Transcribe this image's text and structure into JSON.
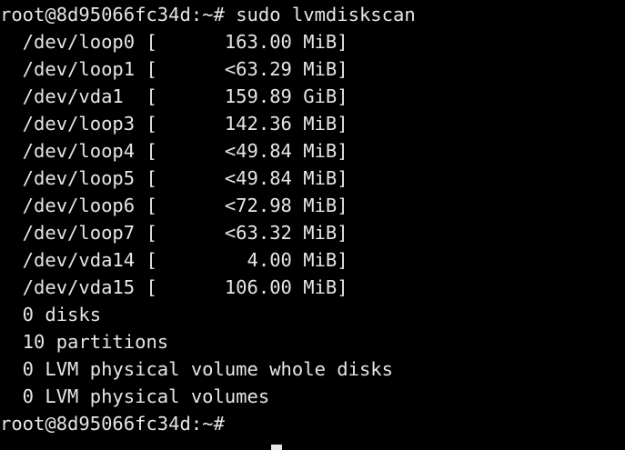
{
  "terminal": {
    "colors": {
      "background": "#000000",
      "foreground": "#e6e6e6"
    },
    "prompt": "root@8d95066fc34d:~#",
    "command": "sudo lvmdiskscan",
    "output": [
      "  /dev/loop0 [      163.00 MiB]",
      "  /dev/loop1 [      <63.29 MiB]",
      "  /dev/vda1  [      159.89 GiB]",
      "  /dev/loop3 [      142.36 MiB]",
      "  /dev/loop4 [      <49.84 MiB]",
      "  /dev/loop5 [      <49.84 MiB]",
      "  /dev/loop6 [      <72.98 MiB]",
      "  /dev/loop7 [      <63.32 MiB]",
      "  /dev/vda14 [        4.00 MiB]",
      "  /dev/vda15 [      106.00 MiB]",
      "  0 disks",
      "  10 partitions",
      "  0 LVM physical volume whole disks",
      "  0 LVM physical volumes"
    ]
  }
}
